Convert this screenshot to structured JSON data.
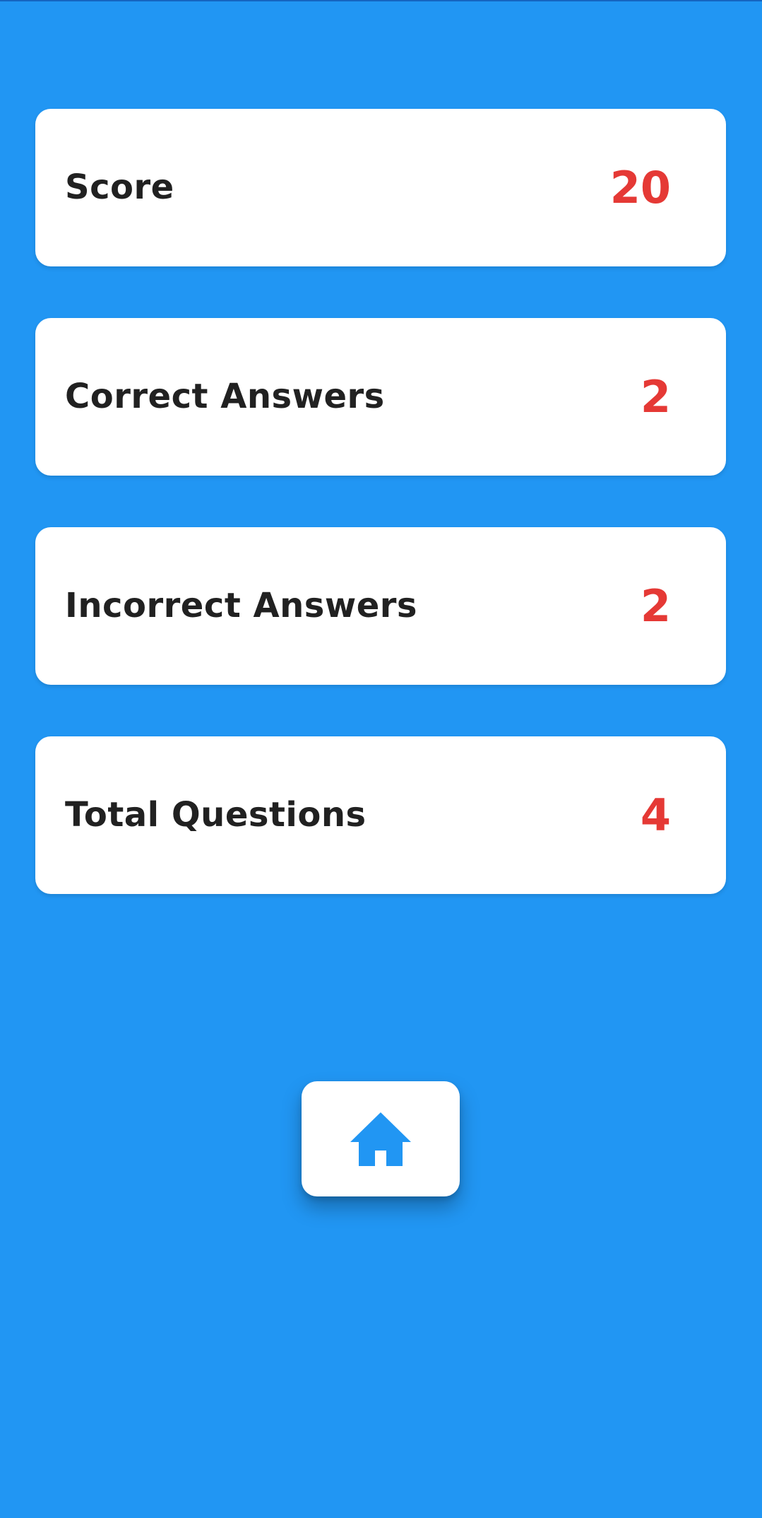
{
  "stats": [
    {
      "label": "Score",
      "value": "20"
    },
    {
      "label": "Correct Answers",
      "value": "2"
    },
    {
      "label": "Incorrect Answers",
      "value": "2"
    },
    {
      "label": "Total Questions",
      "value": "4"
    }
  ],
  "home_button": {
    "icon": "home-icon"
  },
  "colors": {
    "background": "#2196F3",
    "card": "#FFFFFF",
    "label_text": "#212121",
    "value_text": "#E53935"
  }
}
